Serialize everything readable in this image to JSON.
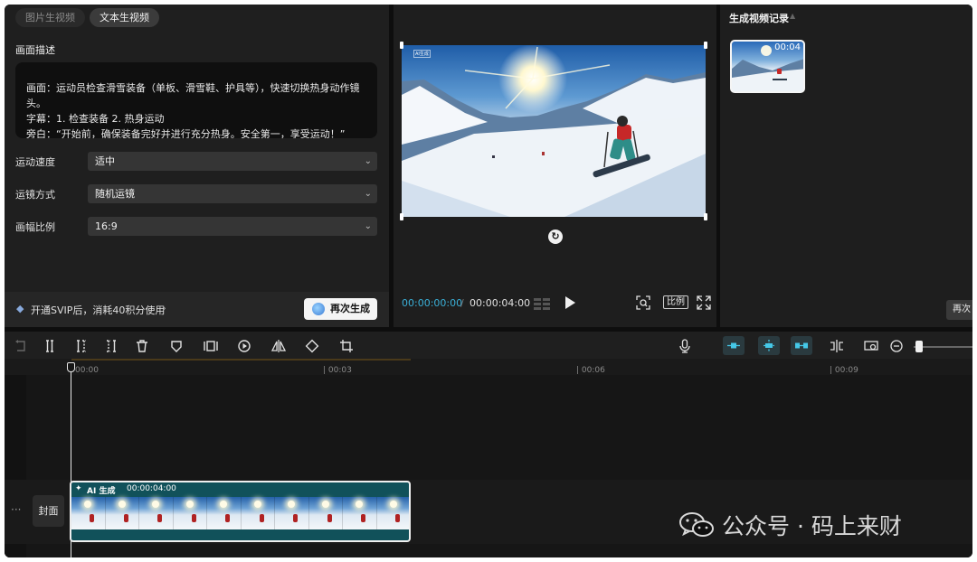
{
  "left": {
    "tabs": [
      "图片生视频",
      "文本生视频"
    ],
    "desc_label": "画面描述",
    "desc_lines": [
      "画面：运动员检查滑雪装备（单板、滑雪鞋、护具等），快速切换热身动作镜头。",
      "字幕：1. 检查装备 2. 热身运动",
      "旁白：“开始前，确保装备完好并进行充分热身。安全第一，享受运动！”"
    ],
    "params": [
      {
        "label": "运动速度",
        "value": "适中"
      },
      {
        "label": "运镜方式",
        "value": "随机运镜"
      },
      {
        "label": "画幅比例",
        "value": "16:9"
      }
    ],
    "footer": {
      "vip_text": "开通SVIP后，消耗40积分使用",
      "regen_label": "再次生成"
    }
  },
  "preview": {
    "watermark_tag": "AI生成",
    "time_current": "00:00:00:00",
    "time_sep": "/",
    "time_total": "00:00:04:00",
    "ratio_label": "比例"
  },
  "history": {
    "title": "生成视频记录",
    "items": [
      {
        "duration": "00:04"
      }
    ],
    "reuse_label": "再次"
  },
  "timeline": {
    "ticks": [
      "00:00",
      "| 00:03",
      "| 00:06",
      "| 00:09"
    ],
    "cover_label": "封面",
    "more_label": "···",
    "clip": {
      "label": "AI 生成",
      "duration": "00:00:04:00",
      "frame_count": 10
    }
  },
  "watermark": {
    "text": "公众号 · 码上来财"
  },
  "colors": {
    "accent": "#3ab0d8",
    "clip": "#11515a",
    "panel": "#1f1f1f"
  },
  "icons": [
    "undo-icon",
    "split-icon",
    "split-left-icon",
    "split-right-icon",
    "delete-icon",
    "shield-icon",
    "freeze-frame-icon",
    "speed-icon",
    "mirror-icon",
    "rotate-icon",
    "crop-icon",
    "mic-icon",
    "link-main-icon",
    "snap-icon",
    "link-track-icon",
    "split-view-icon",
    "preview-icon",
    "zoom-out-icon"
  ]
}
